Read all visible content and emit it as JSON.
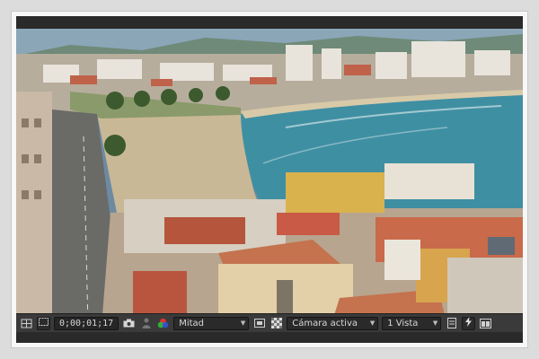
{
  "viewer": {
    "timecode": "0;00;01;17",
    "resolution": {
      "selected": "Mitad"
    },
    "camera": {
      "selected": "Cámara activa"
    },
    "views": {
      "selected": "1 Vista"
    }
  },
  "icons": {
    "grid": "grid-icon",
    "safe_margins": "safe-margins-icon",
    "snapshot": "camera-icon",
    "show_snapshot": "person-icon",
    "channels": "rgb-channels-icon",
    "region": "region-of-interest-icon",
    "transparency": "transparency-grid-icon",
    "fast_preview": "fast-preview-icon",
    "render": "render-icon"
  },
  "colors": {
    "toolbar_bg": "#3a3a3a",
    "panel_bg": "#2e2e2e",
    "sea": "#3f8fa3",
    "sand": "#c9b896",
    "roof_red": "#b5553c",
    "roof_tile": "#c4734e"
  }
}
